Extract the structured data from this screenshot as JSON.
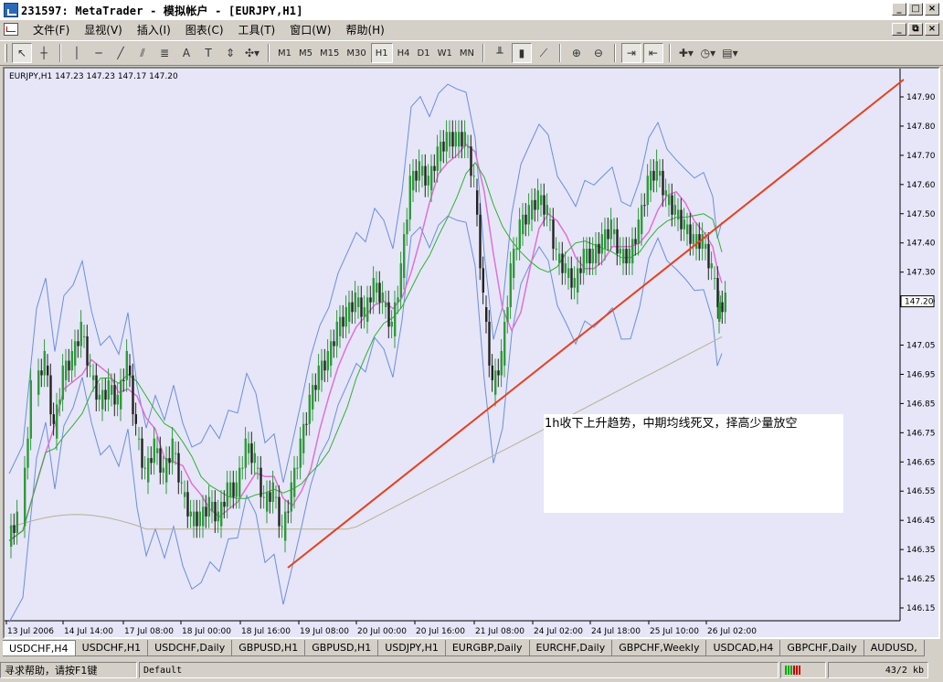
{
  "window": {
    "title": "231597: MetaTrader - 模拟帐户 - [EURJPY,H1]"
  },
  "menu": [
    "文件(F)",
    "显视(V)",
    "插入(I)",
    "图表(C)",
    "工具(T)",
    "窗口(W)",
    "帮助(H)"
  ],
  "toolbar": {
    "timeframes": [
      "M1",
      "M5",
      "M15",
      "M30",
      "H1",
      "H4",
      "D1",
      "W1",
      "MN"
    ],
    "active_timeframe": "H1",
    "text_tool": "A"
  },
  "chart": {
    "header": "EURJPY,H1  147.23 147.23 147.17 147.20",
    "price_labels": [
      "147.90",
      "147.80",
      "147.70",
      "147.60",
      "147.50",
      "147.40",
      "147.30",
      "147.20",
      "147.05",
      "146.95",
      "146.85",
      "146.75",
      "146.65",
      "146.55",
      "146.45",
      "146.35",
      "146.25",
      "146.15"
    ],
    "current_price": "147.20",
    "time_labels": [
      "13 Jul 2006",
      "14 Jul 14:00",
      "17 Jul 08:00",
      "18 Jul 00:00",
      "18 Jul 16:00",
      "19 Jul 08:00",
      "20 Jul 00:00",
      "20 Jul 16:00",
      "21 Jul 08:00",
      "24 Jul 02:00",
      "24 Jul 18:00",
      "25 Jul 10:00",
      "26 Jul 02:00"
    ],
    "annotation": "1h收下上升趋势，中期均线死叉，择高少量放空",
    "colors": {
      "background": "#e6e6f8",
      "trendline": "#e8401c",
      "bull": "#2e9a3a",
      "bear": "#222222",
      "bands": "#6a8ee0",
      "ma_fast": "#e070d8",
      "ma_mid": "#2fb12f",
      "ma_slow": "#b8b090"
    }
  },
  "tabs": [
    "USDCHF,H4",
    "USDCHF,H1",
    "USDCHF,Daily",
    "GBPUSD,H1",
    "GBPUSD,H1",
    "USDJPY,H1",
    "EURGBP,Daily",
    "EURCHF,Daily",
    "GBPCHF,Weekly",
    "USDCAD,H4",
    "GBPCHF,Daily",
    "AUDUSD,"
  ],
  "status": {
    "help": "寻求帮助，请按F1键",
    "profile": "Default",
    "traffic": "43/2 kb"
  }
}
